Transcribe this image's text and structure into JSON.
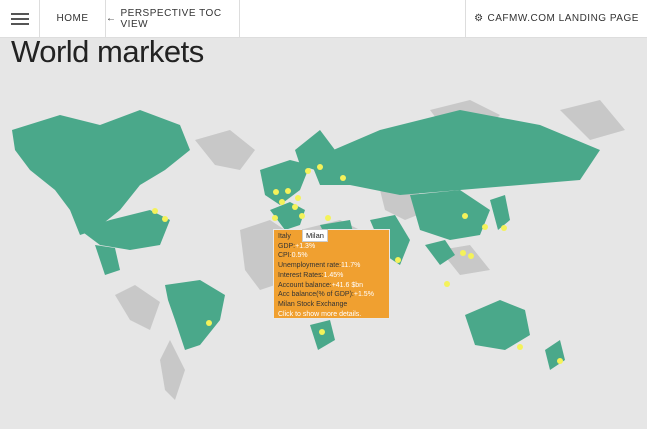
{
  "nav": {
    "home": "HOME",
    "toc": "PERSPECTIVE TOC VIEW",
    "landing": "CAFMW.COM LANDING PAGE"
  },
  "page_title": "World markets",
  "tooltip": {
    "country": "Italy",
    "city": "Milan",
    "gdp_label": "GDP:",
    "gdp_value": "+1.3%",
    "cpi_label": "CPI:",
    "cpi_value": "0.5%",
    "unemp_label": "Unemployment rate:",
    "unemp_value": "11.7%",
    "rates_label": "Interest Rates:",
    "rates_value": "1.45%",
    "account_label": "Account balance:",
    "account_value": "+41.6 $bn",
    "acc_gdp_label": "Acc balance(% of GDP):",
    "acc_gdp_value": "+1.5%",
    "exchange": "Milan Stock Exchange",
    "click_hint": "Click to show more details."
  },
  "colors": {
    "land_active": "#4aa88a",
    "land_inactive": "#c8c8c8",
    "marker": "#f4f25a",
    "tooltip_bg": "#f0a030"
  }
}
